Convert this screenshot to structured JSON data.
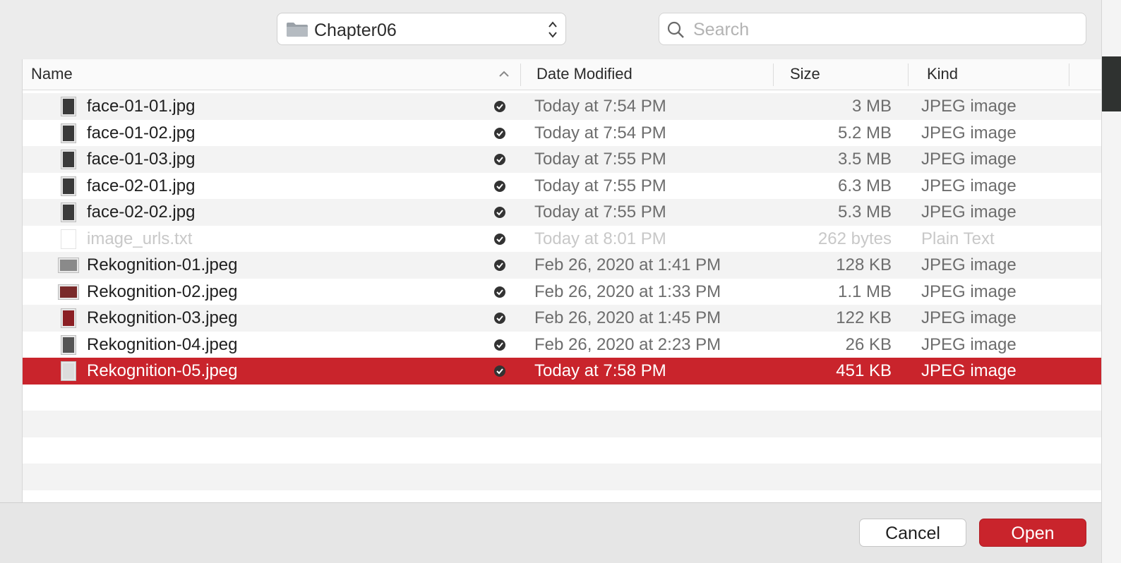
{
  "toolbar": {
    "folder": "Chapter06",
    "search_placeholder": "Search"
  },
  "columns": {
    "name": "Name",
    "date": "Date Modified",
    "size": "Size",
    "kind": "Kind"
  },
  "files": [
    {
      "name": "face-01-01.jpg",
      "date": "Today at 7:54 PM",
      "size": "3 MB",
      "kind": "JPEG image"
    },
    {
      "name": "face-01-02.jpg",
      "date": "Today at 7:54 PM",
      "size": "5.2 MB",
      "kind": "JPEG image"
    },
    {
      "name": "face-01-03.jpg",
      "date": "Today at 7:55 PM",
      "size": "3.5 MB",
      "kind": "JPEG image"
    },
    {
      "name": "face-02-01.jpg",
      "date": "Today at 7:55 PM",
      "size": "6.3 MB",
      "kind": "JPEG image"
    },
    {
      "name": "face-02-02.jpg",
      "date": "Today at 7:55 PM",
      "size": "5.3 MB",
      "kind": "JPEG image"
    },
    {
      "name": "image_urls.txt",
      "date": "Today at 8:01 PM",
      "size": "262 bytes",
      "kind": "Plain Text"
    },
    {
      "name": "Rekognition-01.jpeg",
      "date": "Feb 26, 2020 at 1:41 PM",
      "size": "128 KB",
      "kind": "JPEG image"
    },
    {
      "name": "Rekognition-02.jpeg",
      "date": "Feb 26, 2020 at 1:33 PM",
      "size": "1.1 MB",
      "kind": "JPEG image"
    },
    {
      "name": "Rekognition-03.jpeg",
      "date": "Feb 26, 2020 at 1:45 PM",
      "size": "122 KB",
      "kind": "JPEG image"
    },
    {
      "name": "Rekognition-04.jpeg",
      "date": "Feb 26, 2020 at 2:23 PM",
      "size": "26 KB",
      "kind": "JPEG image"
    },
    {
      "name": "Rekognition-05.jpeg",
      "date": "Today at 7:58 PM",
      "size": "451 KB",
      "kind": "JPEG image"
    }
  ],
  "buttons": {
    "cancel": "Cancel",
    "open": "Open"
  },
  "colors": {
    "accent": "#c9242c"
  }
}
